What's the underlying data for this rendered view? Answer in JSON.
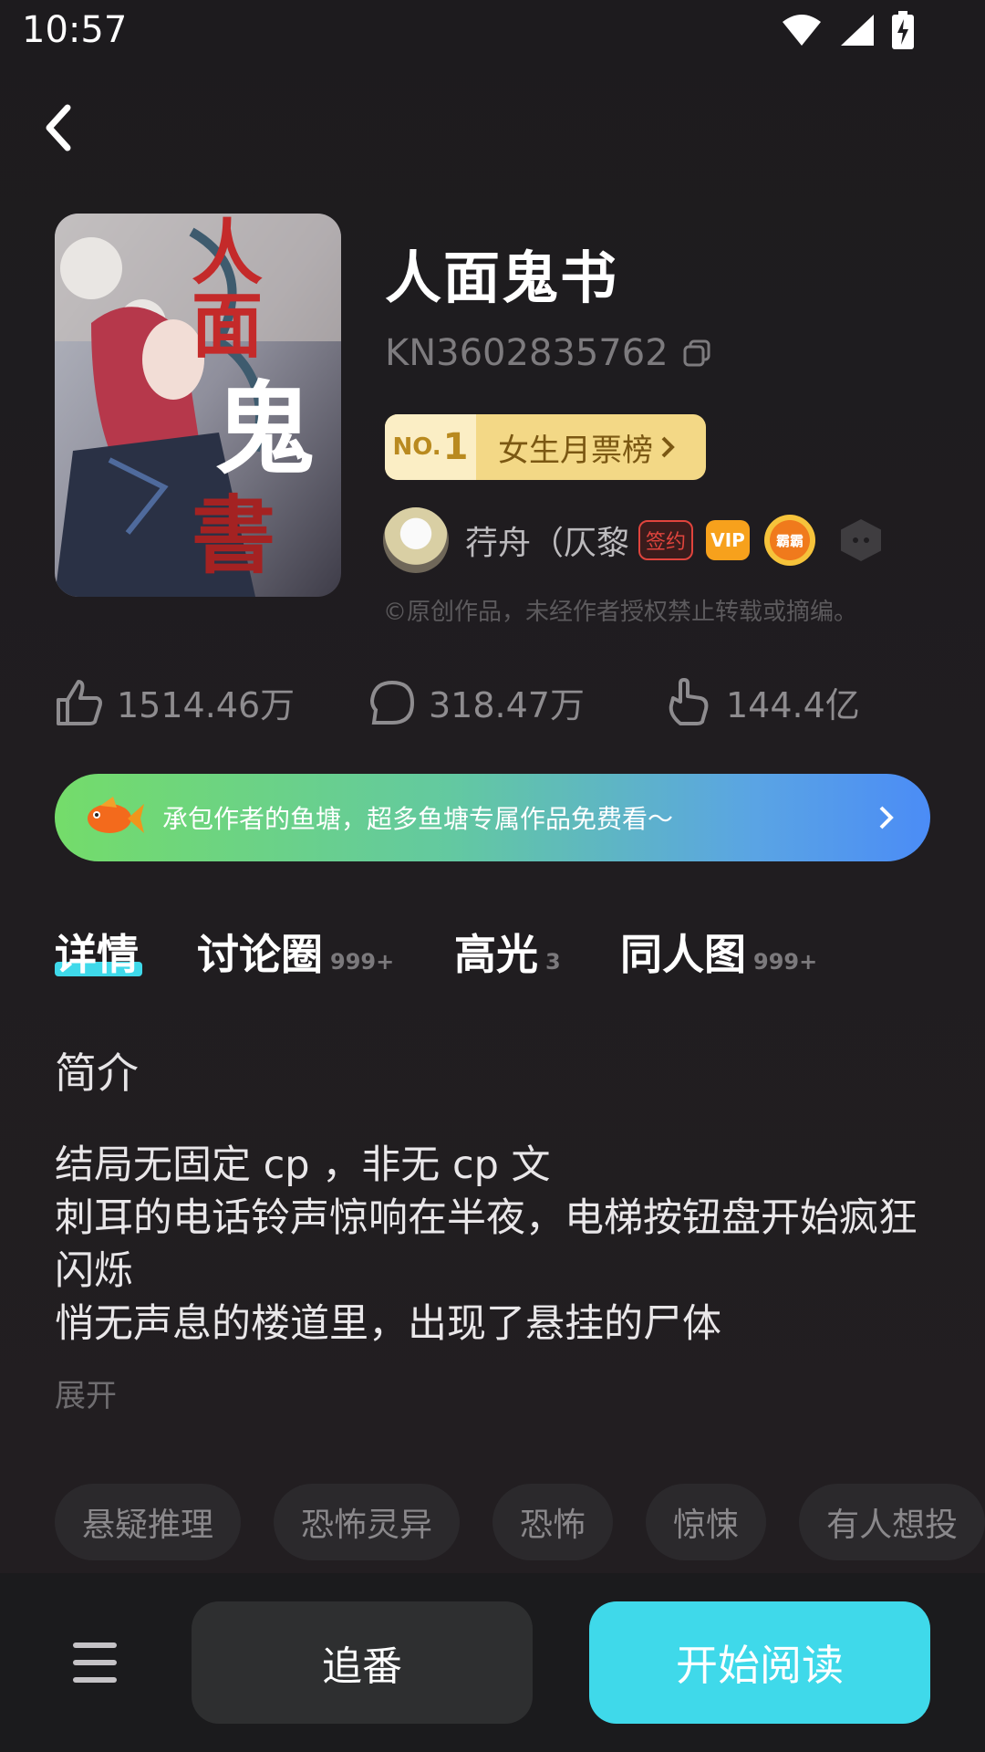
{
  "status_bar": {
    "time": "10:57"
  },
  "book": {
    "title": "人面鬼书",
    "cover_title": "人面鬼書",
    "id": "KN3602835762",
    "rank": {
      "no_prefix": "NO.",
      "no_value": "1",
      "label": "女生月票榜"
    },
    "author": {
      "name": "荇舟（仄黎",
      "sign_badge": "签约",
      "vip_badge": "VIP",
      "level_badge": "霸霸"
    },
    "copyright": "©原创作品，未经作者授权禁止转载或摘编。"
  },
  "stats": {
    "likes": "1514.46万",
    "comments": "318.47万",
    "tickets": "144.4亿"
  },
  "promo": {
    "text": "承包作者的鱼塘，超多鱼塘专属作品免费看～"
  },
  "tabs": [
    {
      "label": "详情",
      "count": ""
    },
    {
      "label": "讨论圈",
      "count": "999+"
    },
    {
      "label": "高光",
      "count": "3"
    },
    {
      "label": "同人图",
      "count": "999+"
    }
  ],
  "synopsis": {
    "title": "简介",
    "lines": [
      "结局无固定 cp ，非无 cp 文",
      "刺耳的电话铃声惊响在半夜，电梯按钮盘开始疯狂闪烁",
      "悄无声息的楼道里，出现了悬挂的尸体"
    ],
    "expand": "展开"
  },
  "tags": [
    "悬疑推理",
    "恐怖灵异",
    "恐怖",
    "惊悚",
    "有人想投"
  ],
  "bottom": {
    "follow": "追番",
    "read": "开始阅读"
  },
  "colors": {
    "accent": "#3fd9ea",
    "background": "#1f1d20"
  }
}
